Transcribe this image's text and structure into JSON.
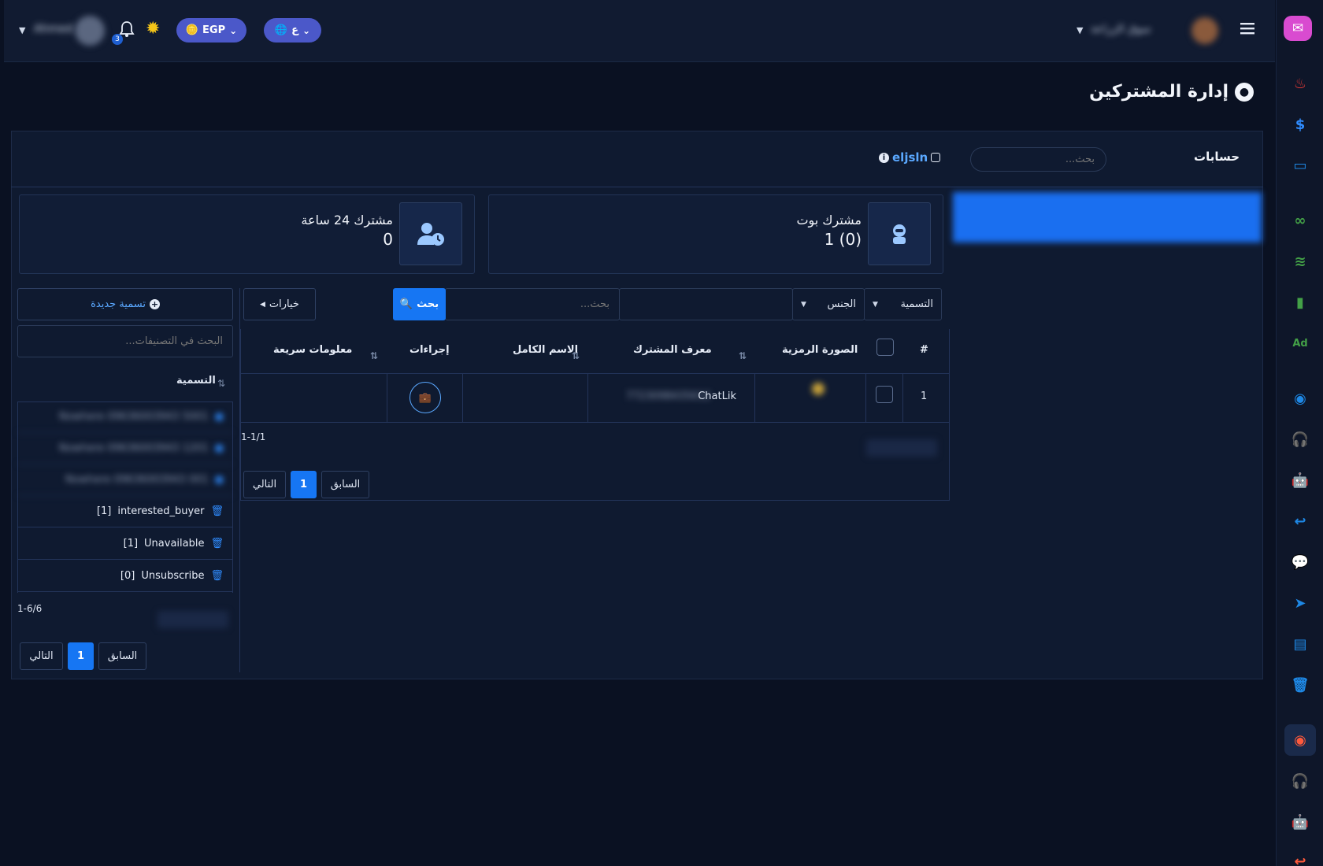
{
  "topbar": {
    "user_name": "Ahmed",
    "notif_count": "3",
    "currency": "EGP",
    "language": "ع",
    "account_name": "سوق الزراعة"
  },
  "page": {
    "title": "إدارة المشتركين"
  },
  "accounts": {
    "label": "حسابات",
    "search_placeholder": "بحث...",
    "active_account": "eljsln"
  },
  "stats": {
    "bot_subscribers_label": "مشترك بوت",
    "bot_subscribers_value": "1 (0)",
    "last24_label": "مشترك 24 ساعة",
    "last24_value": "0"
  },
  "filters": {
    "label_select": "التسمية",
    "gender_select": "الجنس",
    "search_placeholder": "بحث...",
    "search_button": "بحث",
    "options_button": "خيارات"
  },
  "table": {
    "headers": {
      "index": "#",
      "avatar": "الصورة الرمزية",
      "subscriber_id": "معرف المشترك",
      "full_name": "الاسم الكامل",
      "actions": "إجراءات",
      "quick_info": "معلومات سريعة"
    },
    "rows": [
      {
        "index": "1",
        "subscriber_id": "7723098435612",
        "full_name": "ChatLik"
      }
    ],
    "range": "1-1/1",
    "prev": "السابق",
    "page": "1",
    "next": "التالي"
  },
  "labels_panel": {
    "new_label_button": "تسمية جديدة",
    "search_placeholder": "البحث في التصنيفات...",
    "column_header": "التسمية",
    "blurred_items": [
      "Nowhere 09636003943 5001",
      "Nowhere 09636003943 1201",
      "Nowhere 09636003943 001"
    ],
    "items": [
      {
        "name": "interested_buyer",
        "count": "[1]"
      },
      {
        "name": "Unavailable",
        "count": "[1]"
      },
      {
        "name": "Unsubscribe",
        "count": "[0]"
      }
    ],
    "range": "1-6/6",
    "prev": "السابق",
    "page": "1",
    "next": "التالي"
  },
  "colors": {
    "accent": "#1676f3",
    "pill": "#4b58c9",
    "background": "#0a1122"
  }
}
